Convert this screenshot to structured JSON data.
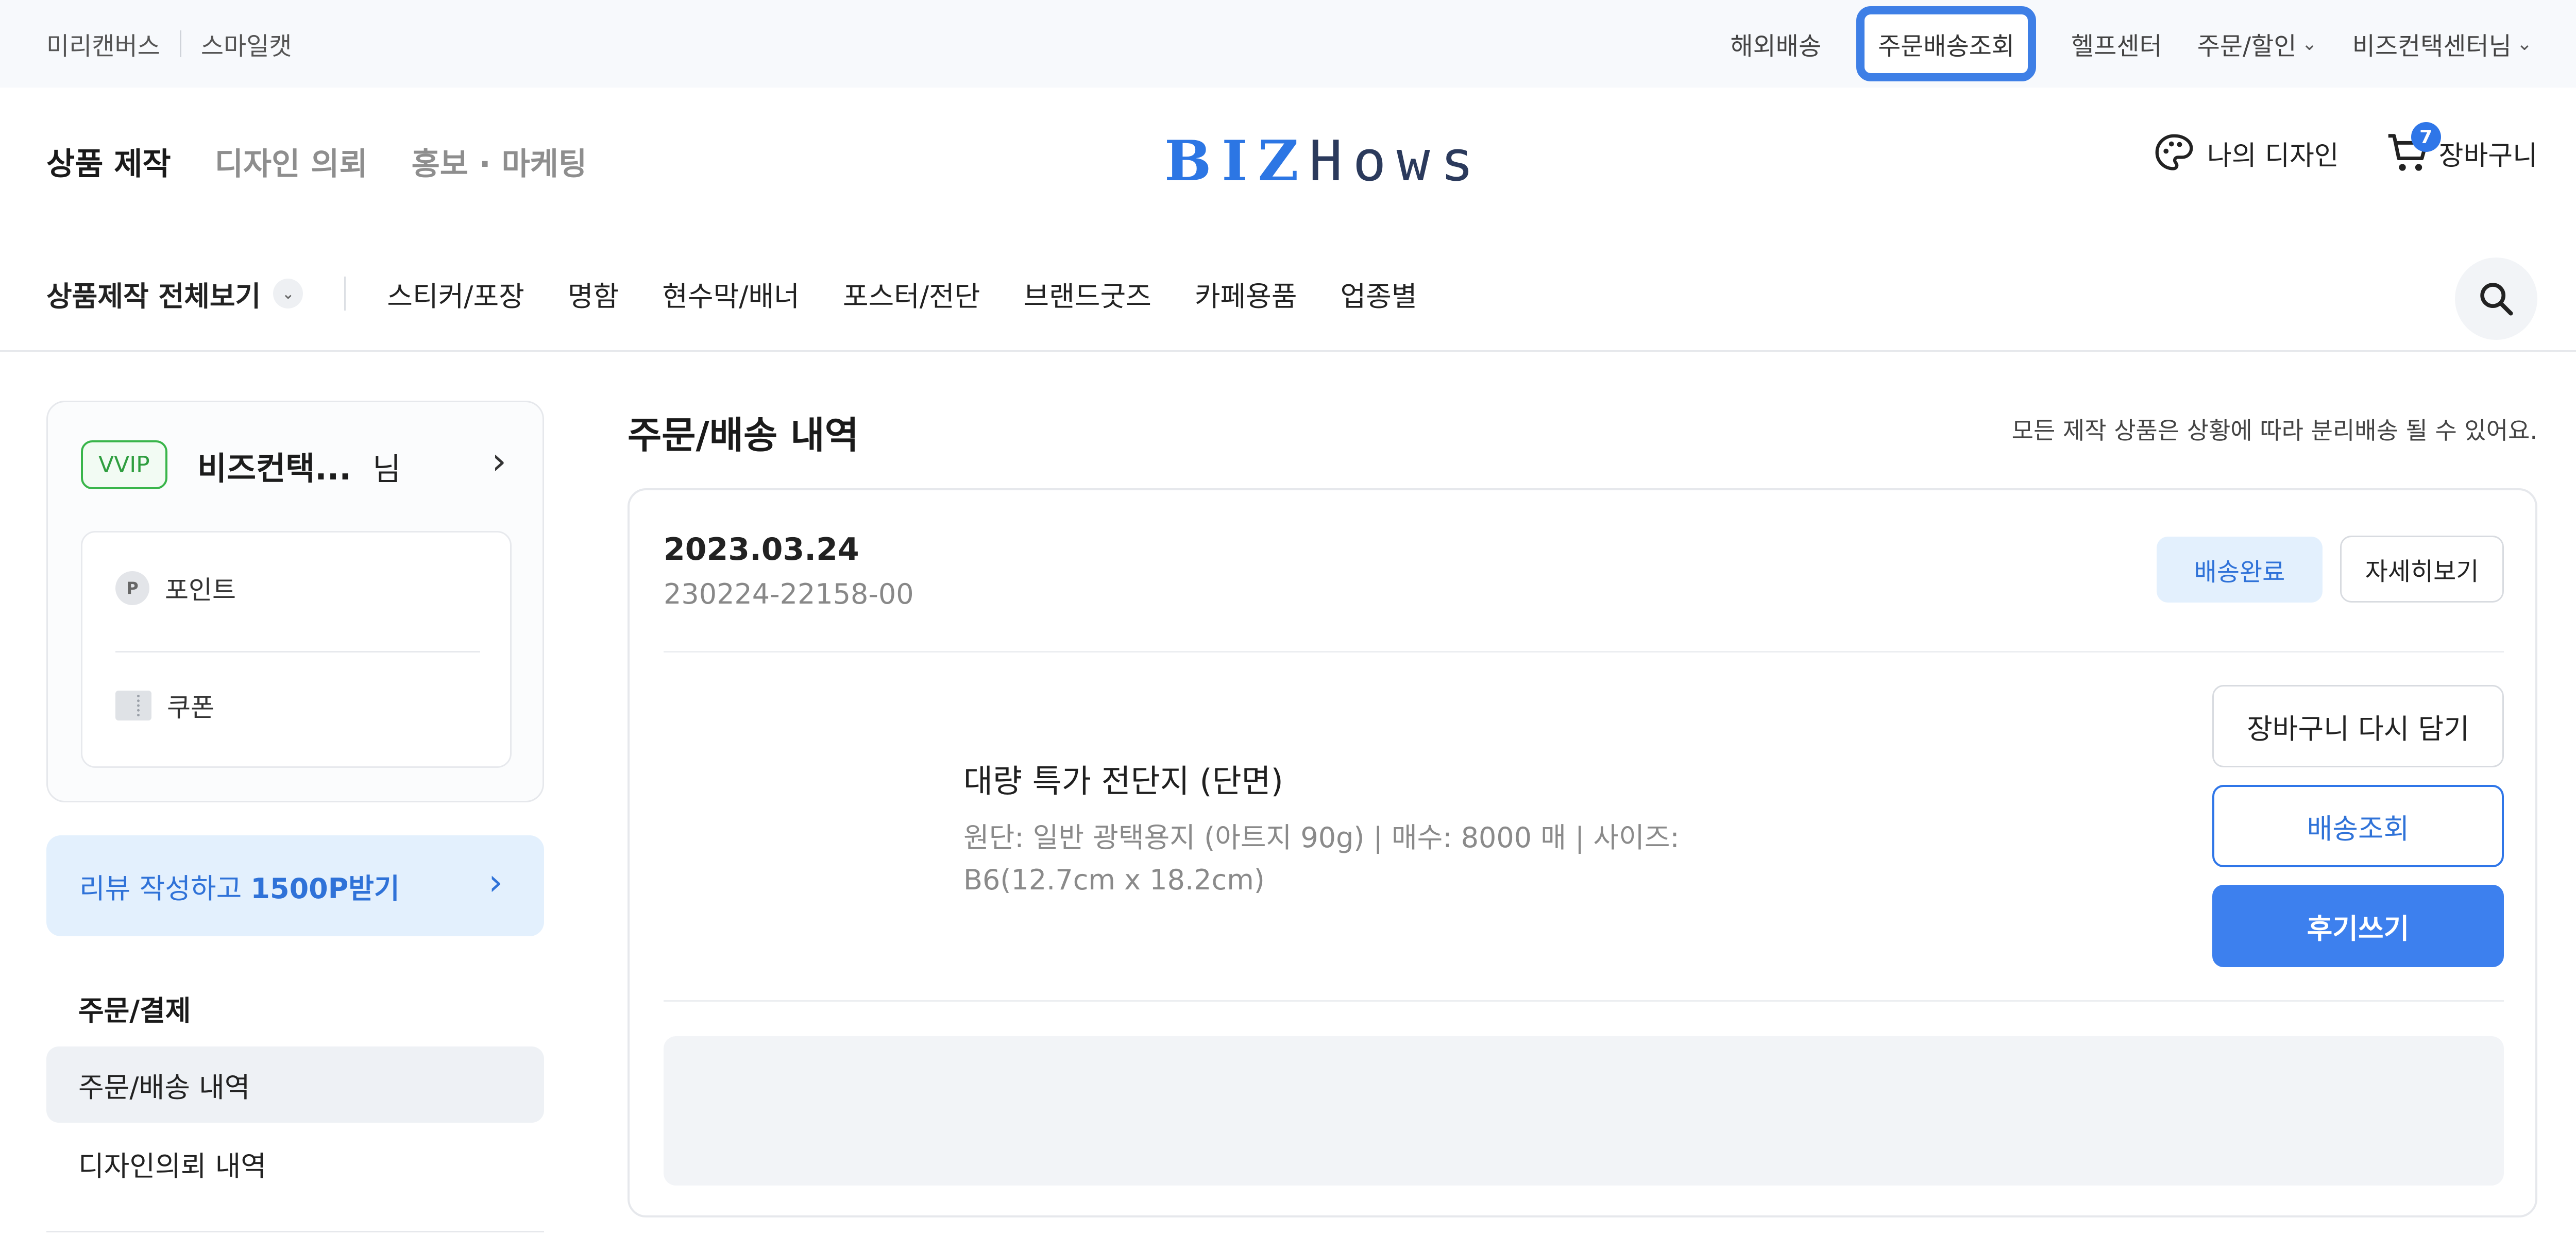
{
  "utility_bar": {
    "left_links": [
      "미리캔버스",
      "스마일캣"
    ],
    "overseas": "해외배송",
    "order_tracking": "주문배송조회",
    "help_center": "헬프센터",
    "order_discount": "주문/할인",
    "user": "비즈컨택센터님"
  },
  "header": {
    "main_nav": [
      "상품 제작",
      "디자인 의뢰",
      "홍보 · 마케팅"
    ],
    "logo_biz": "BIZ",
    "logo_hows": "Hows",
    "my_design": "나의 디자인",
    "cart_label": "장바구니",
    "cart_count": "7",
    "category_all": "상품제작 전체보기",
    "categories": [
      "스티커/포장",
      "명함",
      "현수막/배너",
      "포스터/전단",
      "브랜드굿즈",
      "카페용품",
      "업종별"
    ]
  },
  "sidebar": {
    "grade": "VVIP",
    "member_name": "비즈컨택...",
    "member_suffix": "님",
    "point_icon_letter": "P",
    "point_label": "포인트",
    "coupon_label": "쿠폰",
    "review_banner_prefix": "리뷰 작성하고 ",
    "review_banner_bold": "1500P받기",
    "section_title": "주문/결제",
    "menu_orders": "주문/배송 내역",
    "menu_design": "디자인의뢰 내역"
  },
  "main": {
    "title": "주문/배송 내역",
    "notice": "모든 제작 상품은 상황에 따라 분리배송 될 수 있어요.",
    "order": {
      "date": "2023.03.24",
      "number": "230224-22158-00",
      "status": "배송완료",
      "detail_button": "자세히보기",
      "product_name": "대량 특가 전단지 (단면)",
      "product_spec": "원단: 일반 광택용지 (아트지 90g) | 매수: 8000 매 | 사이즈: B6(12.7cm x 18.2cm)",
      "recart_button": "장바구니 다시 담기",
      "track_button": "배송조회",
      "review_button": "후기쓰기"
    }
  },
  "colors": {
    "accent": "#3d80ee",
    "highlight_outline": "#3e7fe6",
    "vvip_green": "#39b54a",
    "status_bg": "#e3f0fd"
  },
  "icons": [
    "palette-icon",
    "cart-icon",
    "search-icon",
    "chevron-down-icon",
    "chevron-right-icon",
    "point-icon",
    "coupon-icon"
  ]
}
